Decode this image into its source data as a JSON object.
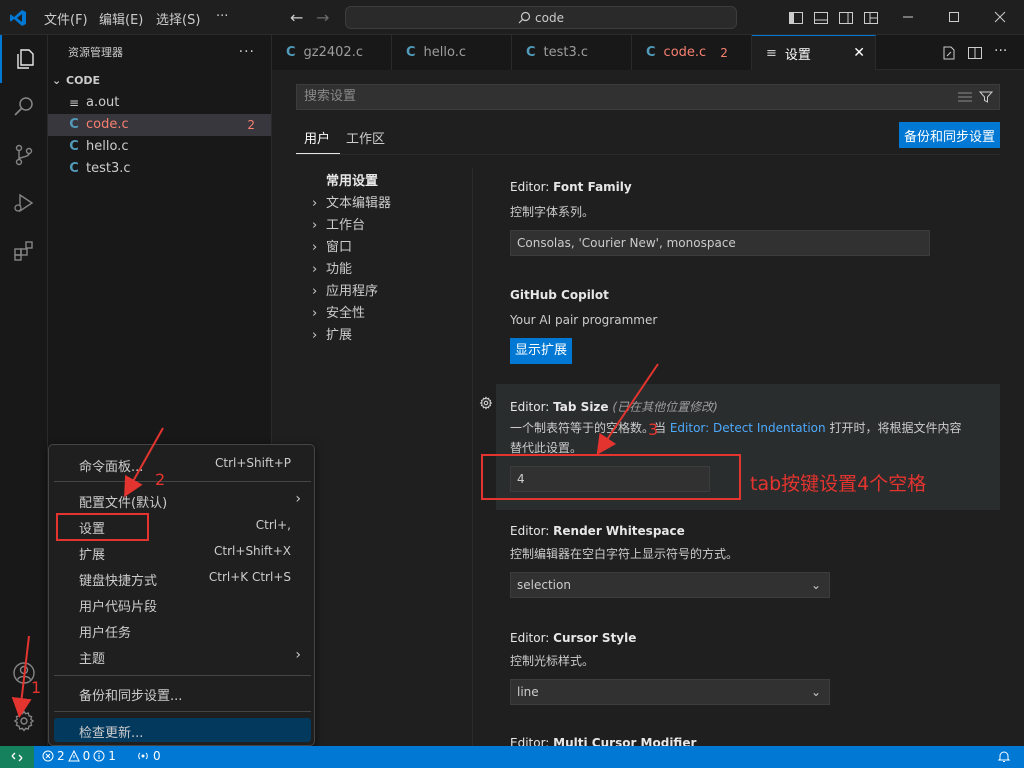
{
  "titlebar": {
    "menus": [
      "文件(F)",
      "编辑(E)",
      "选择(S)"
    ],
    "more": "···",
    "search_text": "code"
  },
  "sidebar": {
    "title": "资源管理器",
    "more": "···",
    "folder": "CODE",
    "files": [
      {
        "icon": "≡",
        "name": "a.out"
      },
      {
        "icon": "C",
        "name": "code.c",
        "badge": "2"
      },
      {
        "icon": "C",
        "name": "hello.c"
      },
      {
        "icon": "C",
        "name": "test3.c"
      }
    ]
  },
  "tabs": [
    {
      "icon": "C",
      "label": "gz2402.c"
    },
    {
      "icon": "C",
      "label": "hello.c"
    },
    {
      "icon": "C",
      "label": "test3.c"
    },
    {
      "icon": "C",
      "label": "code.c",
      "badge": "2"
    },
    {
      "icon": "≡",
      "label": "设置",
      "close": "✕"
    }
  ],
  "settings": {
    "search_placeholder": "搜索设置",
    "scope_tabs": [
      "用户",
      "工作区"
    ],
    "backup_button": "备份和同步设置",
    "toc": {
      "heading": "常用设置",
      "items": [
        "文本编辑器",
        "工作台",
        "窗口",
        "功能",
        "应用程序",
        "安全性",
        "扩展"
      ]
    },
    "items": [
      {
        "category": "Editor: ",
        "name": "Font Family",
        "desc": "控制字体系列。",
        "value": "Consolas, 'Courier New', monospace"
      },
      {
        "name": "GitHub Copilot",
        "desc": "Your AI pair programmer",
        "button": "显示扩展"
      },
      {
        "category": "Editor: ",
        "name": "Tab Size",
        "modified": "(已在其他位置修改)",
        "desc_before": "一个制表符等于的空格数。当 ",
        "desc_link": "Editor: Detect Indentation",
        "desc_after": " 打开时，将根据文件内容",
        "desc_line2": "替代此设置。",
        "value": "4"
      },
      {
        "category": "Editor: ",
        "name": "Render Whitespace",
        "desc": "控制编辑器在空白字符上显示符号的方式。",
        "value": "selection"
      },
      {
        "category": "Editor: ",
        "name": "Cursor Style",
        "desc": "控制光标样式。",
        "value": "line"
      },
      {
        "category": "Editor: ",
        "name": "Multi Cursor Modifier"
      }
    ]
  },
  "context_menu": {
    "items": [
      {
        "label": "命令面板...",
        "key": "Ctrl+Shift+P"
      },
      {
        "label": "配置文件(默认)",
        "key": ""
      },
      {
        "label": "设置",
        "key": "Ctrl+,"
      },
      {
        "label": "扩展",
        "key": "Ctrl+Shift+X"
      },
      {
        "label": "键盘快捷方式",
        "key": "Ctrl+K Ctrl+S"
      },
      {
        "label": "用户代码片段",
        "key": ""
      },
      {
        "label": "用户任务",
        "key": ""
      },
      {
        "label": "主题",
        "key": ""
      },
      {
        "label": "备份和同步设置...",
        "key": ""
      },
      {
        "label": "检查更新...",
        "key": ""
      }
    ]
  },
  "statusbar": {
    "errors": "2",
    "warnings": "0",
    "info": "1",
    "ports": "0"
  },
  "annotations": {
    "step1": "1",
    "step2": "2",
    "step3": "3",
    "note": "tab按键设置4个空格",
    "color": "#e3342f"
  },
  "colors": {
    "accent": "#0078d4",
    "error": "#f88070",
    "c_icon": "#519aba"
  }
}
